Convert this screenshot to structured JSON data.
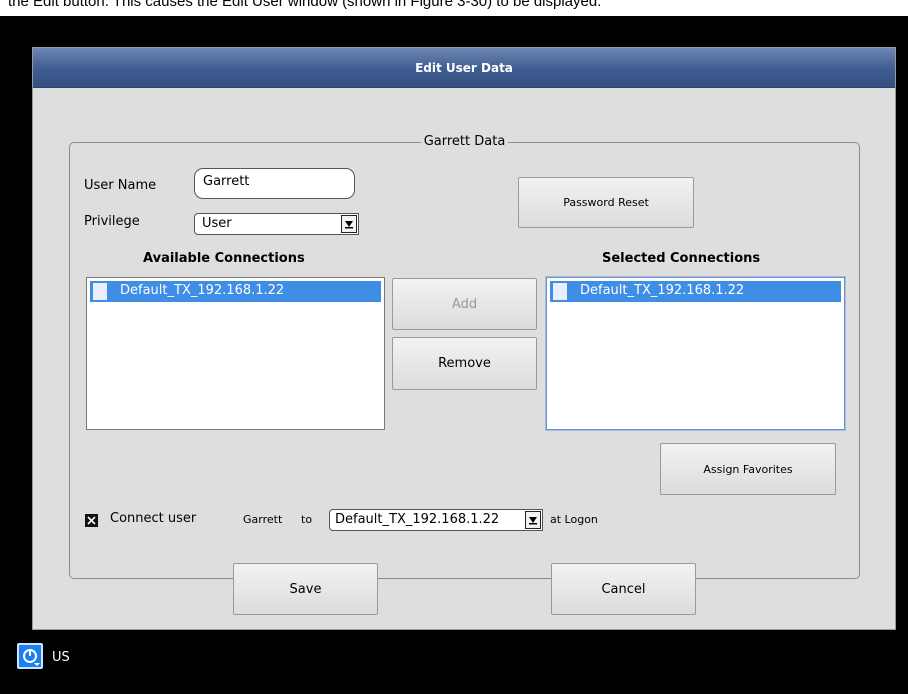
{
  "caption": "the Edit button. This causes the Edit User window (shown in Figure 3-30) to be displayed.",
  "window": {
    "title": "Edit User Data"
  },
  "group": {
    "legend": "Garrett Data"
  },
  "form": {
    "username_label": "User Name",
    "username_value": "Garrett",
    "privilege_label": "Privilege",
    "privilege_value": "User",
    "password_reset": "Password Reset"
  },
  "available": {
    "heading": "Available Connections",
    "items": [
      "Default_TX_192.168.1.22"
    ]
  },
  "selected": {
    "heading": "Selected Connections",
    "items": [
      "Default_TX_192.168.1.22"
    ]
  },
  "buttons": {
    "add": "Add",
    "remove": "Remove",
    "assign_favorites": "Assign Favorites",
    "save": "Save",
    "cancel": "Cancel"
  },
  "connect": {
    "label": "Connect user",
    "user": "Garrett",
    "to": "to",
    "target": "Default_TX_192.168.1.22",
    "at_logon": "at Logon",
    "checked": true
  },
  "status": {
    "locale": "US"
  },
  "icons": {
    "dropdown": "chevron-down-icon",
    "checkbox": "checkbox-x-icon",
    "keyboard": "power-keyboard-icon"
  },
  "colors": {
    "titlebar": "#3f5c92",
    "selection": "#3f8ee6",
    "window_bg": "#dedede",
    "status_bg": "#000000"
  }
}
